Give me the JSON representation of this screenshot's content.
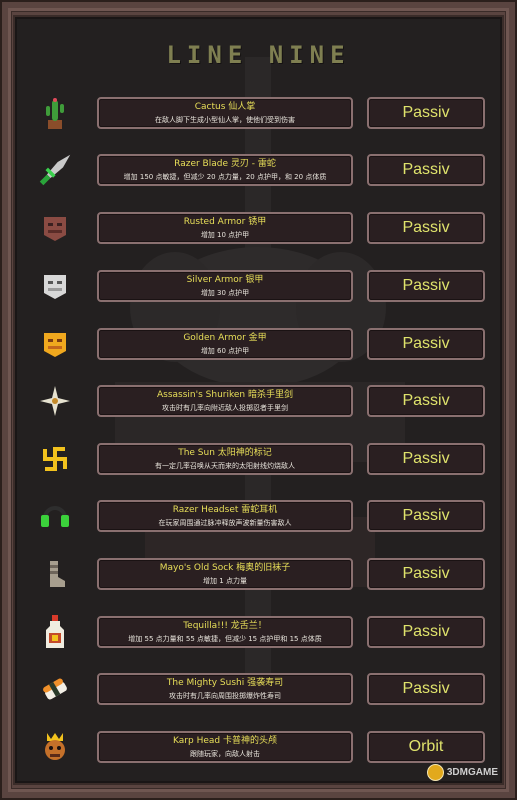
{
  "title": "LINE NINE",
  "items": [
    {
      "name": "Cactus 仙人掌",
      "desc": "在敌人脚下生成小型仙人掌，使他们受到伤害",
      "tag": "Passiv",
      "icon": "cactus-icon"
    },
    {
      "name": "Razer Blade 灵刃 - 雷蛇",
      "desc": "增加 150 点敏捷，但减少 20 点力量，20 点护甲，和 20 点体质",
      "tag": "Passiv",
      "icon": "razer-blade-icon"
    },
    {
      "name": "Rusted Armor 锈甲",
      "desc": "增加 10 点护甲",
      "tag": "Passiv",
      "icon": "rusted-armor-icon"
    },
    {
      "name": "Silver Armor 银甲",
      "desc": "增加 30 点护甲",
      "tag": "Passiv",
      "icon": "silver-armor-icon"
    },
    {
      "name": "Golden Armor 金甲",
      "desc": "增加 60 点护甲",
      "tag": "Passiv",
      "icon": "golden-armor-icon"
    },
    {
      "name": "Assassin's Shuriken 暗杀手里剑",
      "desc": "攻击时有几率向附近敌人投掷忍者手里剑",
      "tag": "Passiv",
      "icon": "shuriken-icon"
    },
    {
      "name": "The Sun 太阳神的标记",
      "desc": "有一定几率召唤从天而来的太阳射线灼烧敌人",
      "tag": "Passiv",
      "icon": "sun-symbol-icon"
    },
    {
      "name": "Razer Headset 雷蛇耳机",
      "desc": "在玩家周围通过脉冲释放声波新量伤害敌人",
      "tag": "Passiv",
      "icon": "headset-icon"
    },
    {
      "name": "Mayo's Old Sock 梅奥的旧袜子",
      "desc": "增加 1 点力量",
      "tag": "Passiv",
      "icon": "sock-icon"
    },
    {
      "name": "Tequilla!!! 龙舌兰！",
      "desc": "增加 55 点力量和 55 点敏捷，但减少 15 点护甲和 15 点体质",
      "tag": "Passiv",
      "icon": "tequila-bottle-icon"
    },
    {
      "name": "The Mighty Sushi 强袭寿司",
      "desc": "攻击时有几率向周围投掷爆炸性寿司",
      "tag": "Passiv",
      "icon": "sushi-icon"
    },
    {
      "name": "Karp Head 卡普神的头颅",
      "desc": "跟随玩家，向敌人射击",
      "tag": "Orbit",
      "icon": "karp-head-icon"
    }
  ],
  "watermark": "3DMGAME",
  "colors": {
    "accent": "#e8df59",
    "tag_text": "#dfe36c",
    "title": "#7f7f51",
    "panel": "#232020",
    "frame": "#5a4440"
  }
}
